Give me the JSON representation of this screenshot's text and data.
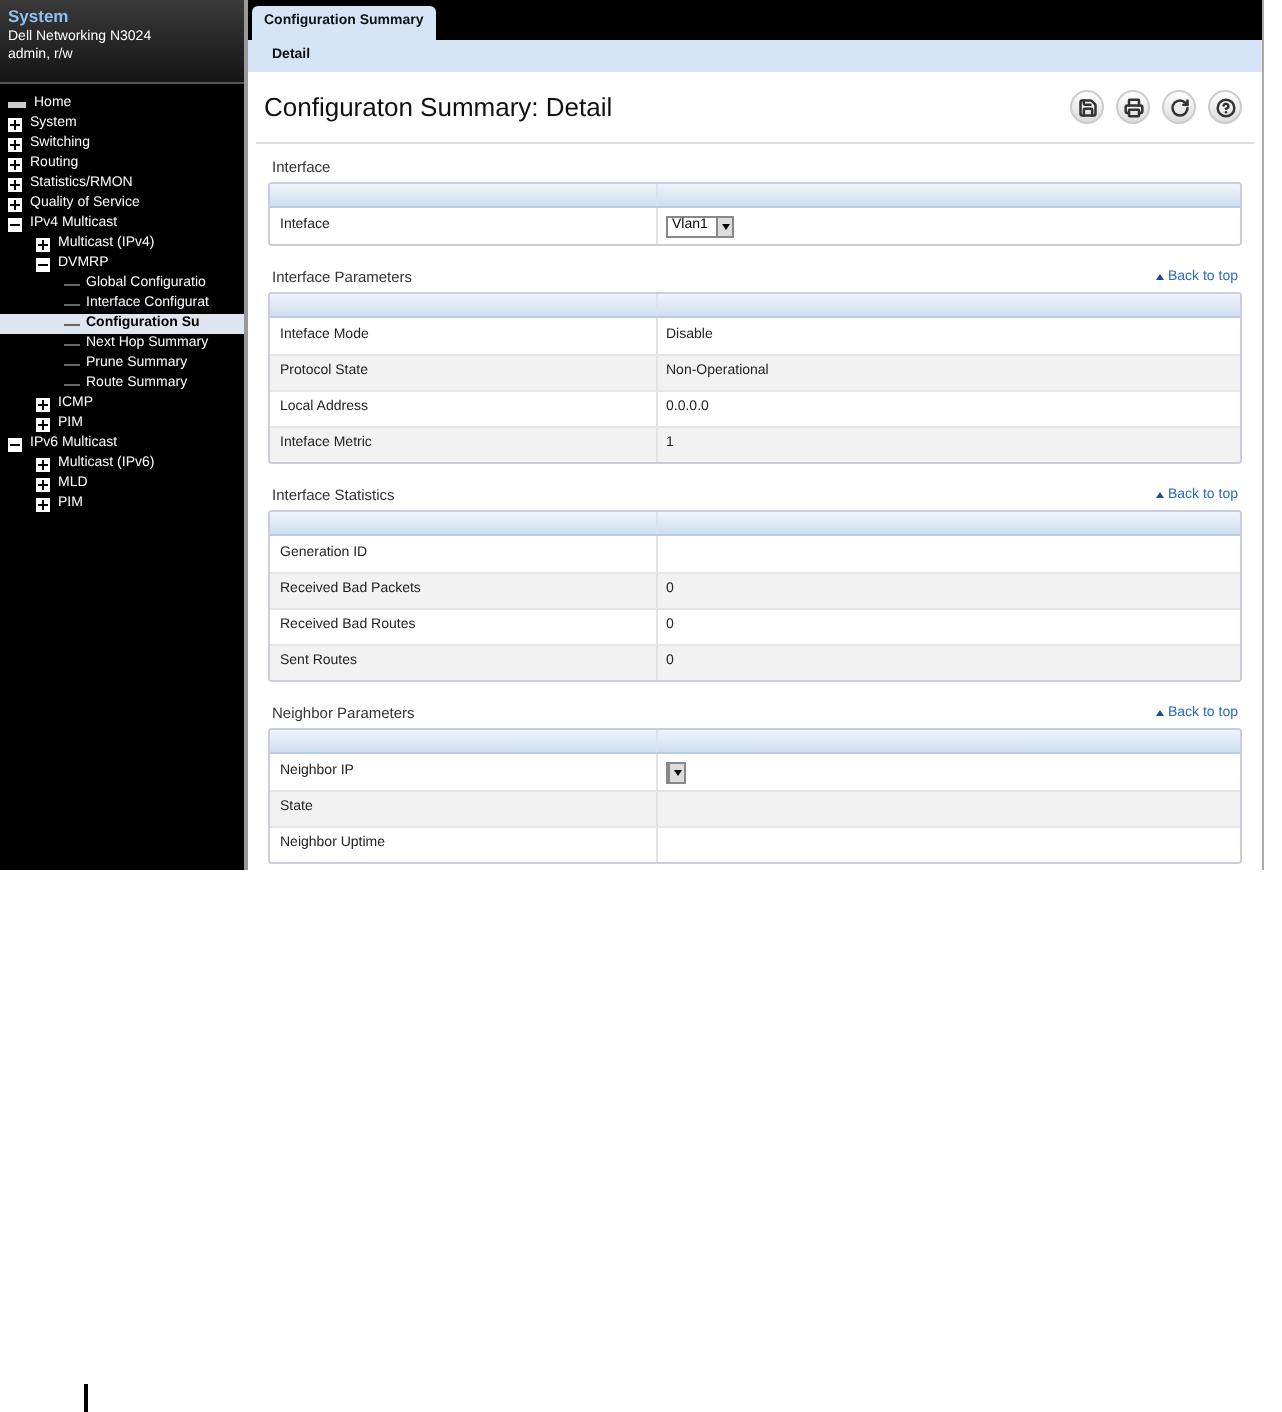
{
  "sidebar": {
    "title": "System",
    "device": "Dell Networking N3024",
    "user": "admin, r/w",
    "tree": [
      {
        "label": "Home",
        "kind": "home",
        "selected": false
      },
      {
        "label": "System",
        "kind": "folder",
        "expanded": false,
        "selected": false
      },
      {
        "label": "Switching",
        "kind": "folder",
        "expanded": false,
        "selected": false
      },
      {
        "label": "Routing",
        "kind": "folder",
        "expanded": false,
        "selected": false
      },
      {
        "label": "Statistics/RMON",
        "kind": "folder",
        "expanded": false,
        "selected": false
      },
      {
        "label": "Quality of Service",
        "kind": "folder",
        "expanded": false,
        "selected": false
      },
      {
        "label": "IPv4 Multicast",
        "kind": "folder",
        "expanded": true,
        "selected": false,
        "children": [
          {
            "label": "Multicast (IPv4)",
            "kind": "folder",
            "expanded": false,
            "selected": false
          },
          {
            "label": "DVMRP",
            "kind": "folder",
            "expanded": true,
            "selected": false,
            "children": [
              {
                "label": "Global Configuratio",
                "kind": "page",
                "selected": false
              },
              {
                "label": "Interface Configurat",
                "kind": "page",
                "selected": false
              },
              {
                "label": "Configuration Su",
                "kind": "page",
                "selected": true
              },
              {
                "label": "Next Hop Summary",
                "kind": "page",
                "selected": false
              },
              {
                "label": "Prune Summary",
                "kind": "page",
                "selected": false
              },
              {
                "label": "Route Summary",
                "kind": "page",
                "selected": false
              }
            ]
          },
          {
            "label": "ICMP",
            "kind": "folder",
            "expanded": false,
            "selected": false
          },
          {
            "label": "PIM",
            "kind": "folder",
            "expanded": false,
            "selected": false
          }
        ]
      },
      {
        "label": "IPv6 Multicast",
        "kind": "folder",
        "expanded": true,
        "selected": false,
        "children": [
          {
            "label": "Multicast (IPv6)",
            "kind": "folder",
            "expanded": false,
            "selected": false
          },
          {
            "label": "MLD",
            "kind": "folder",
            "expanded": false,
            "selected": false
          },
          {
            "label": "PIM",
            "kind": "folder",
            "expanded": false,
            "selected": false
          }
        ]
      }
    ]
  },
  "tabs": [
    {
      "label": "Configuration Summary",
      "selected": true
    }
  ],
  "sub_tabs": [
    {
      "label": "Detail",
      "selected": true
    }
  ],
  "page_title": "Configuraton Summary: Detail",
  "sections": [
    {
      "title": "Interface",
      "rows": [
        {
          "label": "Inteface",
          "kind": "select",
          "value": "Vlan1"
        }
      ]
    },
    {
      "title": "Interface Parameters",
      "back_link": "Back to top",
      "rows": [
        {
          "label": "Inteface Mode",
          "kind": "text",
          "value": "Disable"
        },
        {
          "label": "Protocol State",
          "kind": "text",
          "value": "Non-Operational"
        },
        {
          "label": "Local Address",
          "kind": "text",
          "value": "0.0.0.0"
        },
        {
          "label": "Inteface Metric",
          "kind": "text",
          "value": "1"
        }
      ]
    },
    {
      "title": "Interface Statistics",
      "back_link": "Back to top",
      "rows": [
        {
          "label": "Generation ID",
          "kind": "text"
        },
        {
          "label": "Received Bad Packets",
          "kind": "text",
          "value": "0"
        },
        {
          "label": "Received Bad Routes",
          "kind": "text",
          "value": "0"
        },
        {
          "label": "Sent Routes",
          "kind": "text",
          "value": "0"
        }
      ]
    },
    {
      "title": "Neighbor Parameters",
      "back_link": "Back to top",
      "rows": [
        {
          "label": "Neighbor IP",
          "kind": "select"
        },
        {
          "label": "State",
          "kind": "text"
        },
        {
          "label": "Neighbor Uptime",
          "kind": "text"
        }
      ]
    }
  ]
}
